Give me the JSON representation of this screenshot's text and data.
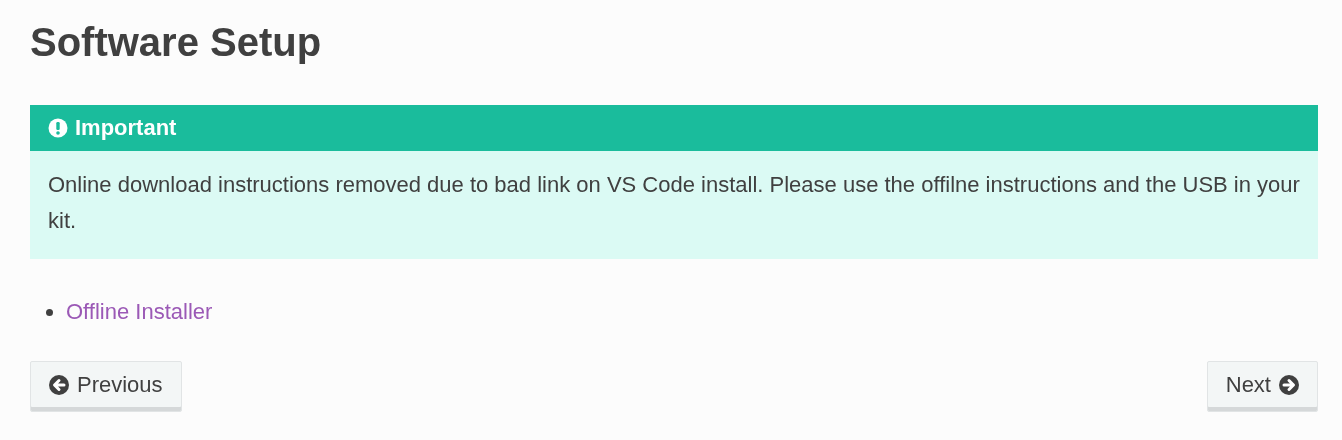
{
  "page": {
    "title": "Software Setup"
  },
  "admonition": {
    "title": "Important",
    "body": "Online download instructions removed due to bad link on VS Code install. Please use the offilne instructions and the USB in your kit."
  },
  "links": [
    {
      "label": "Offline Installer"
    }
  ],
  "nav": {
    "previous": "Previous",
    "next": "Next"
  }
}
